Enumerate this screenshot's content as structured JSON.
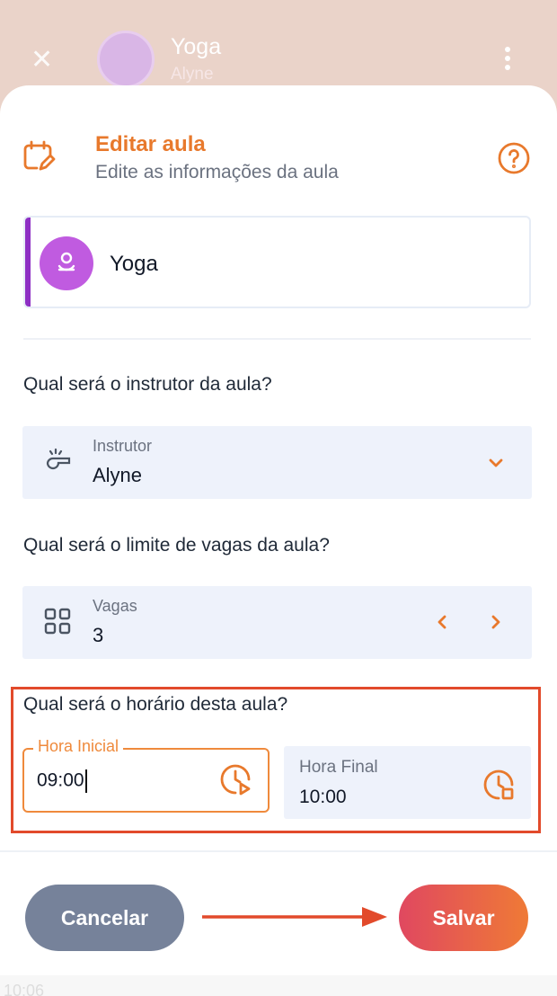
{
  "background": {
    "title": "Yoga",
    "subtitle": "Alyne",
    "footer_time": "10:06"
  },
  "header": {
    "title": "Editar aula",
    "subtitle": "Edite as informações da aula",
    "icon": "calendar-edit-icon",
    "help_icon": "help-circle-icon"
  },
  "class_card": {
    "name": "Yoga",
    "accent_color": "#8e2fc4",
    "avatar_color": "#c05be0"
  },
  "instructor": {
    "question": "Qual será o instrutor da aula?",
    "label": "Instrutor",
    "value": "Alyne",
    "icon": "whistle-icon"
  },
  "spots": {
    "question": "Qual será o limite de vagas da aula?",
    "label": "Vagas",
    "value": "3",
    "icon": "grid-icon"
  },
  "schedule": {
    "question": "Qual será o horário desta aula?",
    "start_label": "Hora Inicial",
    "start_value": "09:00",
    "end_label": "Hora Final",
    "end_value": "10:00"
  },
  "buttons": {
    "cancel": "Cancelar",
    "save": "Salvar"
  },
  "colors": {
    "accent": "#e8792c",
    "highlight": "#e24a2b",
    "cancel_bg": "#76829a"
  }
}
